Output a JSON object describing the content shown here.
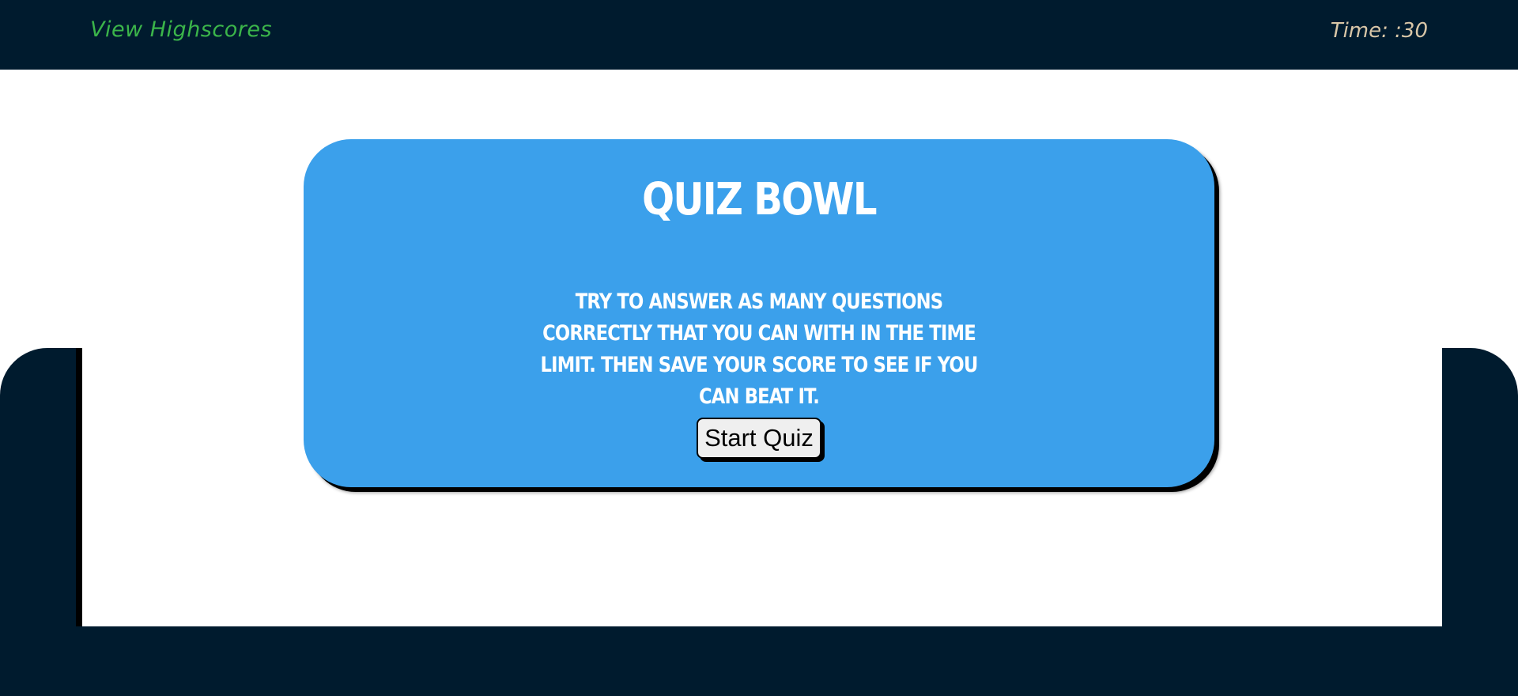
{
  "header": {
    "highscores_label": "View Highscores",
    "timer_label": "Time: :30"
  },
  "quiz": {
    "title": "Quiz Bowl",
    "instructions": "Try to answer as many questions correctly that you can with in the time limit. Then save your score to see if you can beat it.",
    "start_button_label": "Start Quiz"
  },
  "colors": {
    "header_bg": "#001b2e",
    "card_bg": "#3ba0eb",
    "highscores_link": "#3bb54a",
    "timer_text": "#d9c7a8"
  }
}
